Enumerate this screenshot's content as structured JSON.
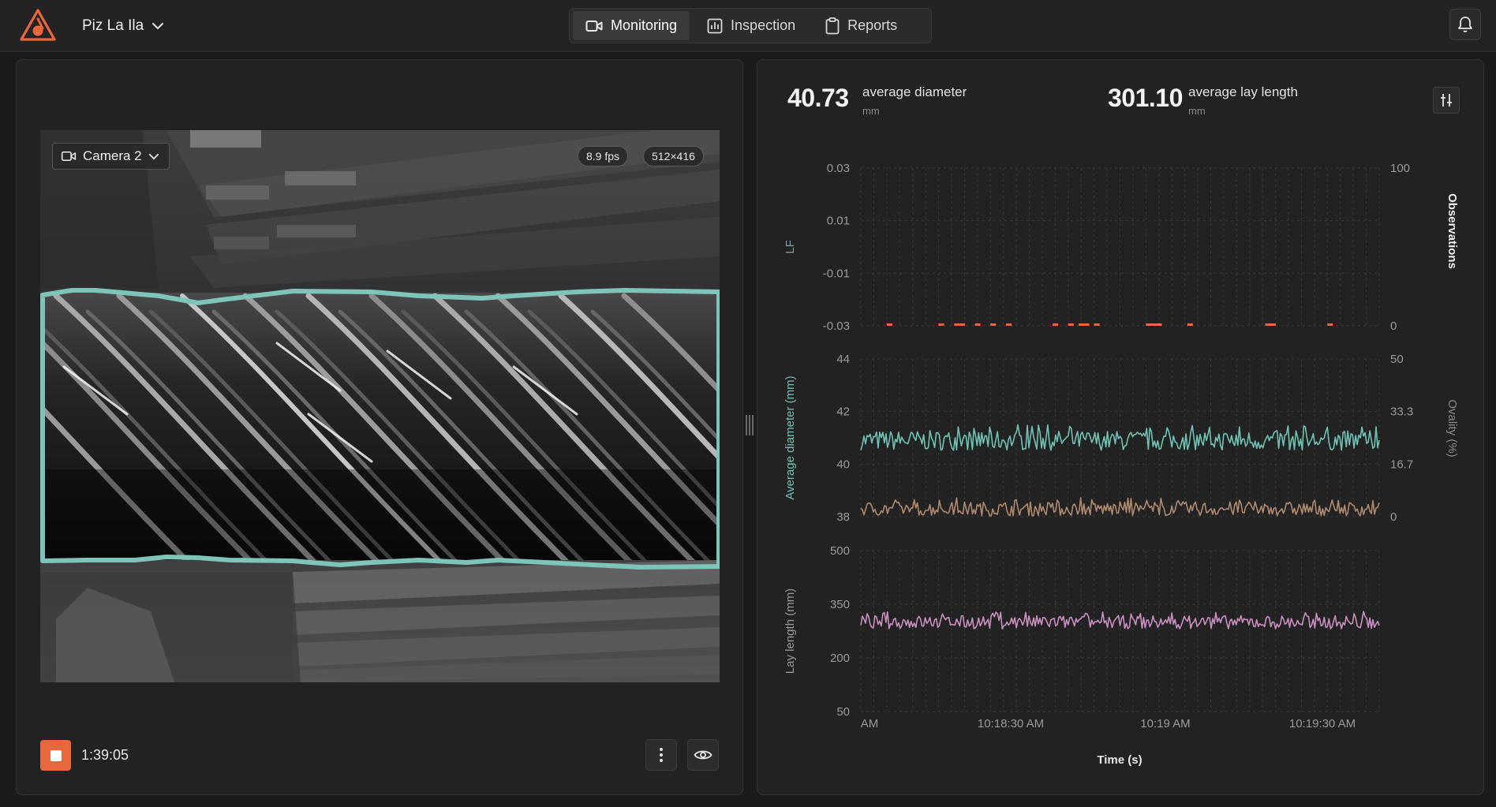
{
  "header": {
    "project_name": "Piz La Ila",
    "nav": [
      {
        "label": "Monitoring",
        "icon": "video-camera-icon",
        "active": true
      },
      {
        "label": "Inspection",
        "icon": "bar-chart-icon",
        "active": false
      },
      {
        "label": "Reports",
        "icon": "clipboard-icon",
        "active": false
      }
    ],
    "accent_color": "#e8673c"
  },
  "camera": {
    "selected": "Camera 2",
    "fps": "8.9 fps",
    "resolution": "512×416",
    "overlay_color": "#7ec4b8",
    "timer": "1:39:05"
  },
  "stats": {
    "diameter_value": "40.73",
    "diameter_label": "average diameter",
    "diameter_unit": "mm",
    "lay_value": "301.10",
    "lay_label": "average lay length",
    "lay_unit": "mm"
  },
  "chart_data": [
    {
      "type": "scatter",
      "ylabel": "LF",
      "y2label": "Observations",
      "y_ticks": [
        "0.03",
        "0.01",
        "-0.01",
        "-0.03"
      ],
      "y2_ticks": [
        "100",
        "0"
      ],
      "ylim": [
        -0.03,
        0.03
      ],
      "y2lim": [
        0,
        100
      ],
      "series": [
        {
          "color": "#e8673c",
          "description": "sparse observation markers at baseline",
          "x_fraction": [
            0.05,
            0.15,
            0.18,
            0.19,
            0.22,
            0.25,
            0.28,
            0.37,
            0.4,
            0.42,
            0.43,
            0.45,
            0.55,
            0.56,
            0.57,
            0.63,
            0.78,
            0.79,
            0.9
          ]
        }
      ],
      "grid": true
    },
    {
      "type": "line",
      "ylabel": "Average diameter (mm)",
      "y2label": "Ovality (%)",
      "y_ticks": [
        "44",
        "42",
        "40",
        "38"
      ],
      "y2_ticks": [
        "50",
        "33.3",
        "16.7",
        "0"
      ],
      "ylim": [
        38,
        44
      ],
      "y2lim": [
        0,
        50
      ],
      "series": [
        {
          "axis": "left",
          "color": "#6fc2b4",
          "mean": 40.9,
          "range": [
            40.5,
            41.5
          ]
        },
        {
          "axis": "right",
          "color": "#b08a70",
          "mean": 2.5,
          "range": [
            0,
            6
          ]
        }
      ],
      "grid": true
    },
    {
      "type": "line",
      "ylabel": "Lay length (mm)",
      "y_ticks": [
        "500",
        "350",
        "200",
        "50"
      ],
      "ylim": [
        50,
        500
      ],
      "series": [
        {
          "color": "#c98fc0",
          "mean": 300,
          "range": [
            280,
            330
          ]
        }
      ],
      "xlabel": "Time (s)",
      "x_ticks": [
        "AM",
        "10:18:30 AM",
        "10:19 AM",
        "10:19:30 AM"
      ],
      "grid": true
    }
  ]
}
